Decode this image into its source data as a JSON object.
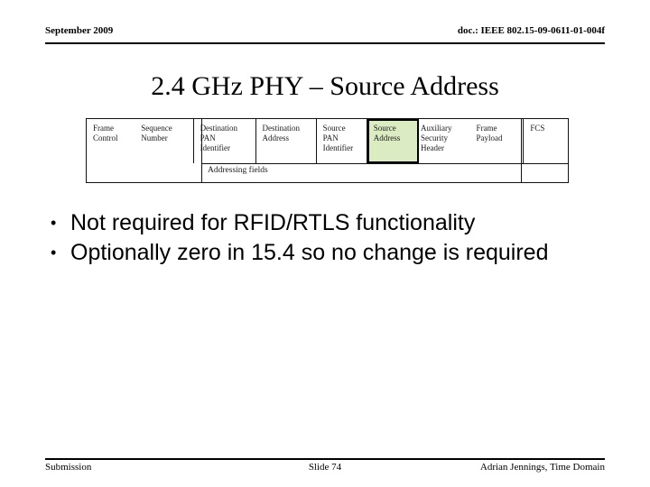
{
  "header": {
    "date": "September 2009",
    "doc_id": "doc.: IEEE 802.15-09-0611-01-004f"
  },
  "title": "2.4 GHz PHY – Source Address",
  "frame_figure": {
    "highlight_color": "#dcecc2",
    "highlight_field": "Source Address",
    "span_label": "Addressing fields",
    "fields": [
      {
        "label": "Frame Control",
        "lines": [
          "Frame",
          "Control"
        ]
      },
      {
        "label": "Sequence Number",
        "lines": [
          "Sequence",
          "Number"
        ]
      },
      {
        "label": "Destination PAN Identifier",
        "lines": [
          "Destination",
          "PAN",
          "Identifier"
        ]
      },
      {
        "label": "Destination Address",
        "lines": [
          "Destination",
          "Address"
        ]
      },
      {
        "label": "Source PAN Identifier",
        "lines": [
          "Source",
          "PAN",
          "Identifier"
        ]
      },
      {
        "label": "Source Address",
        "lines": [
          "Source",
          "Address"
        ]
      },
      {
        "label": "Auxiliary Security Header",
        "lines": [
          "Auxiliary",
          "Security",
          "Header"
        ]
      },
      {
        "label": "Frame Payload",
        "lines": [
          "Frame",
          "Payload"
        ]
      },
      {
        "label": "FCS",
        "lines": [
          "FCS"
        ]
      }
    ]
  },
  "bullets": [
    {
      "marker": "•",
      "text": "Not required for RFID/RTLS functionality"
    },
    {
      "marker": "•",
      "text": "Optionally zero in 15.4 so no change is required"
    }
  ],
  "footer": {
    "left": "Submission",
    "center": "Slide 74",
    "right": "Adrian Jennings, Time Domain"
  }
}
